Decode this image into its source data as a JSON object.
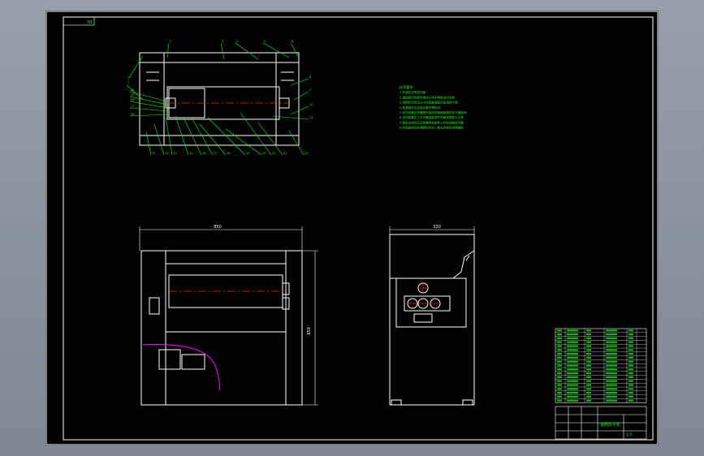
{
  "colors": {
    "background": "#000000",
    "outline": "#ffffff",
    "leader": "#00ff00",
    "centerline": "#ff2020",
    "curve": "#ff00ff",
    "viewport": "#8c959e"
  },
  "drawing": {
    "tech_notes": [
      "技术要求",
      "1.外观应无明显划痕",
      "2.装配前所有零件清洗干净不得有油污毛刺",
      "3.滚筒转动灵活无卡滞现象装配后应运转平稳",
      "4.各紧固件应连接可靠不得松动",
      "5.电气线路应布置整齐接线牢固绝缘良好并可靠接地",
      "6.加热装置应工作可靠温度调节灵敏准确显示正常",
      "7.整机运转时无异常噪声各部件工作协调稳定可靠",
      "8.外表面喷涂处理颜色均匀一致无流挂起泡等缺陷"
    ],
    "top_view_leader_labels": [
      "1",
      "2",
      "3",
      "4",
      "5",
      "6",
      "7",
      "8",
      "9",
      "10",
      "11",
      "12",
      "13",
      "14",
      "15",
      "16",
      "17",
      "18",
      "19",
      "20",
      "21",
      "22",
      "23",
      "24",
      "25",
      "26",
      "27",
      "28"
    ],
    "front_view": {
      "width_dim": "850",
      "height_dim": "650"
    },
    "side_view": {
      "width_dim": "330"
    },
    "title_block": {
      "drawing_name": "滚筒熨平机",
      "scale": "1:5"
    }
  }
}
